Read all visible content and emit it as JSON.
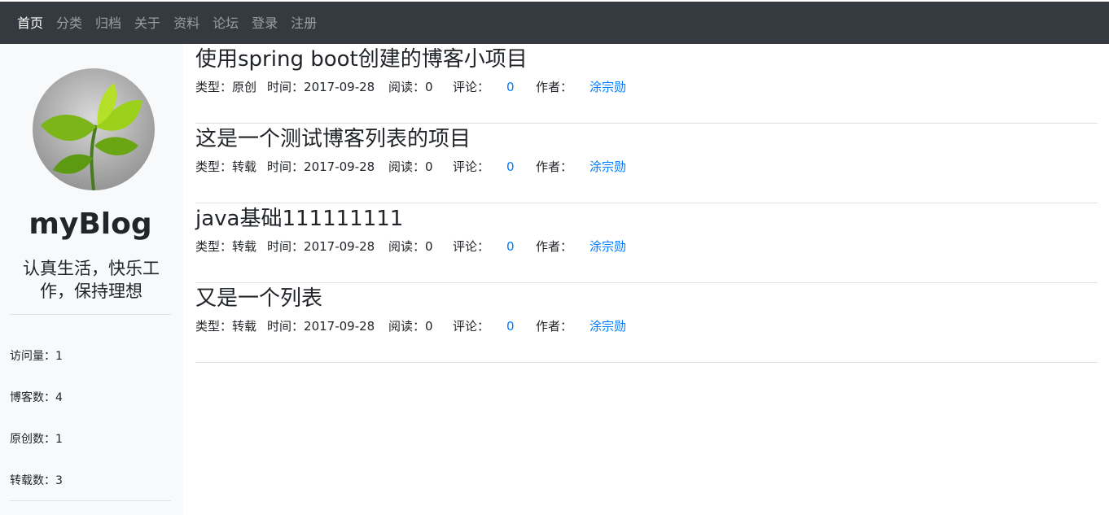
{
  "nav": {
    "items": [
      {
        "label": "首页"
      },
      {
        "label": "分类"
      },
      {
        "label": "归档"
      },
      {
        "label": "关于"
      },
      {
        "label": "资料"
      },
      {
        "label": "论坛"
      },
      {
        "label": "登录"
      },
      {
        "label": "注册"
      }
    ]
  },
  "sidebar": {
    "site_name": "myBlog",
    "motto": "认真生活，快乐工作，保持理想",
    "stats": [
      {
        "label": "访问量：",
        "value": "1"
      },
      {
        "label": "博客数：",
        "value": "4"
      },
      {
        "label": "原创数：",
        "value": "1"
      },
      {
        "label": "转载数：",
        "value": "3"
      }
    ]
  },
  "posts": [
    {
      "title": "使用spring boot创建的博客小项目",
      "type_label": "类型：",
      "type": "原创",
      "time_label": "时间：",
      "time": "2017-09-28",
      "reads_label": "阅读：",
      "reads": "0",
      "comments_label": "评论：",
      "comments": "0",
      "author_label": "作者：",
      "author": "涂宗勋"
    },
    {
      "title": "这是一个测试博客列表的项目",
      "type_label": "类型：",
      "type": "转载",
      "time_label": "时间：",
      "time": "2017-09-28",
      "reads_label": "阅读：",
      "reads": "0",
      "comments_label": "评论：",
      "comments": "0",
      "author_label": "作者：",
      "author": "涂宗勋"
    },
    {
      "title": "java基础111111111",
      "type_label": "类型：",
      "type": "转载",
      "time_label": "时间：",
      "time": "2017-09-28",
      "reads_label": "阅读：",
      "reads": "0",
      "comments_label": "评论：",
      "comments": "0",
      "author_label": "作者：",
      "author": "涂宗勋"
    },
    {
      "title": "又是一个列表",
      "type_label": "类型：",
      "type": "转载",
      "time_label": "时间：",
      "time": "2017-09-28",
      "reads_label": "阅读：",
      "reads": "0",
      "comments_label": "评论：",
      "comments": "0",
      "author_label": "作者：",
      "author": "涂宗勋"
    }
  ],
  "colors": {
    "navbar_bg": "#343a40",
    "sidebar_bg": "#f8f9fa",
    "link": "#007bff"
  }
}
